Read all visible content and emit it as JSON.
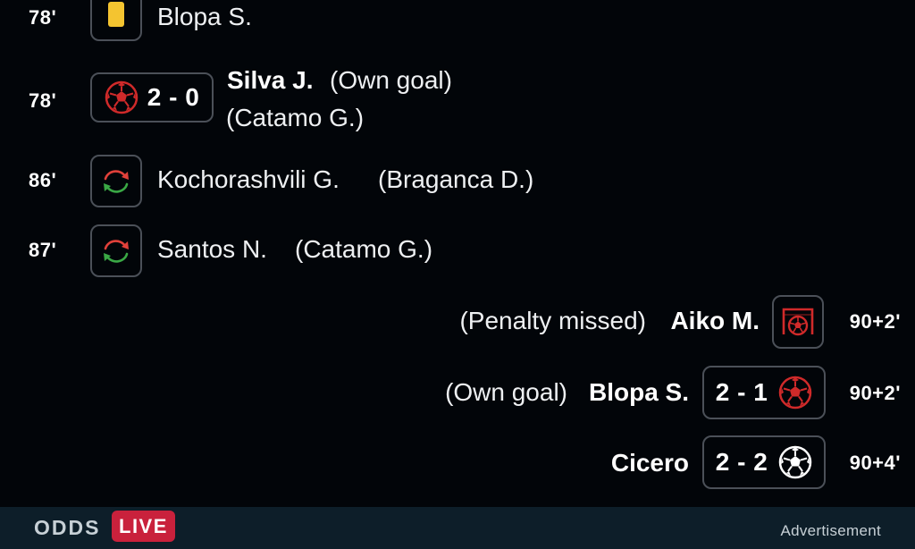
{
  "colors": {
    "background": "#020509",
    "bottom_bar": "#0d1e29",
    "live_badge": "#c9213c",
    "goal_red": "#d02a2a",
    "yellow_card": "#f4c430",
    "sub_green": "#3aa845"
  },
  "events": [
    {
      "minute": "78'",
      "icon": "yellow-card-icon",
      "player": "Blopa S."
    },
    {
      "minute": "78'",
      "icon": "ball-red-icon",
      "score": "2 - 0",
      "player": "Silva J.",
      "note": "(Own goal)",
      "assist": "(Catamo G.)"
    },
    {
      "minute": "86'",
      "icon": "substitution-icon",
      "player": "Kochorashvili G.",
      "assist": "(Braganca D.)"
    },
    {
      "minute": "87'",
      "icon": "substitution-icon",
      "player": "Santos N.",
      "assist": "(Catamo G.)"
    },
    {
      "minute": "90+2'",
      "icon": "missed-penalty-icon",
      "player": "Aiko M.",
      "note": "(Penalty missed)"
    },
    {
      "minute": "90+2'",
      "icon": "ball-red-icon",
      "score": "2 - 1",
      "player": "Blopa S.",
      "note": "(Own goal)"
    },
    {
      "minute": "90+4'",
      "icon": "ball-white-icon",
      "score": "2 - 2",
      "player": "Cicero"
    }
  ],
  "footer": {
    "odds_label": "ODDS",
    "live_label": "LIVE",
    "advertisement": "Advertisement"
  }
}
